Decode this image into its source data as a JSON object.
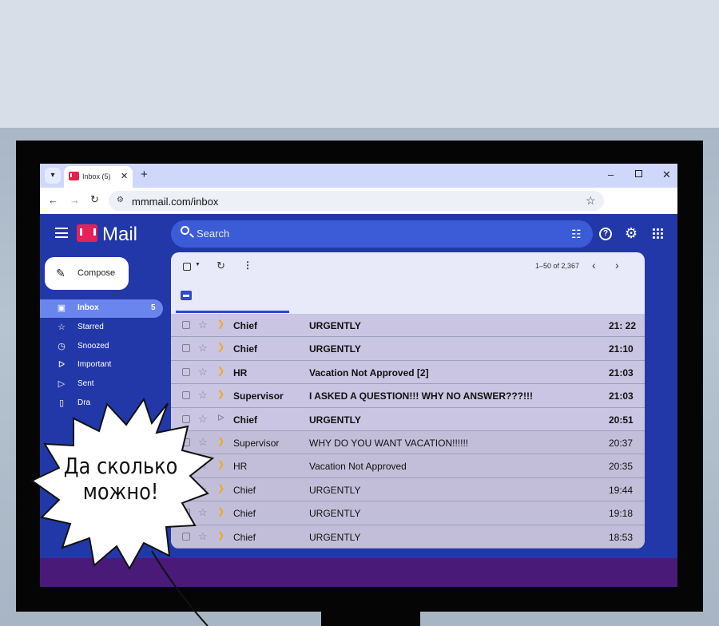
{
  "browser": {
    "tab_title": "Inbox (5)",
    "tab_close": "✕",
    "new_tab": "+",
    "url": "mmmail.com/inbox",
    "window_controls": {
      "minimize": "–",
      "close": "✕"
    }
  },
  "header": {
    "logo_text": "Mail",
    "search_placeholder": "Search"
  },
  "sidebar": {
    "compose_label": "Compose",
    "items": [
      {
        "label": "Inbox",
        "icon": "inbox-icon",
        "count": "5",
        "active": true
      },
      {
        "label": "Starred",
        "icon": "star-icon"
      },
      {
        "label": "Snoozed",
        "icon": "clock-icon"
      },
      {
        "label": "Important",
        "icon": "important-icon"
      },
      {
        "label": "Sent",
        "icon": "send-icon"
      },
      {
        "label": "Dra",
        "icon": "draft-icon"
      }
    ]
  },
  "toolbar": {
    "pagination": "1–50 of 2,367"
  },
  "emails": [
    {
      "sender": "Chief",
      "subject": "URGENTLY",
      "time": "21: 22",
      "unread": true,
      "important": true
    },
    {
      "sender": "Chief",
      "subject": "URGENTLY",
      "time": "21:10",
      "unread": true,
      "important": true
    },
    {
      "sender": "HR",
      "subject": "Vacation Not Approved [2]",
      "time": "21:03",
      "unread": true,
      "important": true
    },
    {
      "sender": "Supervisor",
      "subject": "I ASKED A QUESTION!!! WHY NO ANSWER???!!!",
      "time": "21:03",
      "unread": true,
      "important": true
    },
    {
      "sender": "Chief",
      "subject": "URGENTLY",
      "time": "20:51",
      "unread": true,
      "important": false
    },
    {
      "sender": "Supervisor",
      "subject": "WHY DO YOU WANT VACATION!!!!!!",
      "time": "20:37",
      "unread": false,
      "important": true
    },
    {
      "sender": "HR",
      "subject": "Vacation Not Approved",
      "time": "20:35",
      "unread": false,
      "important": true
    },
    {
      "sender": "Chief",
      "subject": "URGENTLY",
      "time": "19:44",
      "unread": false,
      "important": true
    },
    {
      "sender": "Chief",
      "subject": "URGENTLY",
      "time": "19:18",
      "unread": false,
      "important": true
    },
    {
      "sender": "Chief",
      "subject": "URGENTLY",
      "time": "18:53",
      "unread": false,
      "important": true
    }
  ],
  "speech_bubble": {
    "line1": "Да сколько",
    "line2": "можно!"
  },
  "colors": {
    "app_background": "#2338a8",
    "important_marker": "#f3a915",
    "logo": "#e8205a"
  }
}
